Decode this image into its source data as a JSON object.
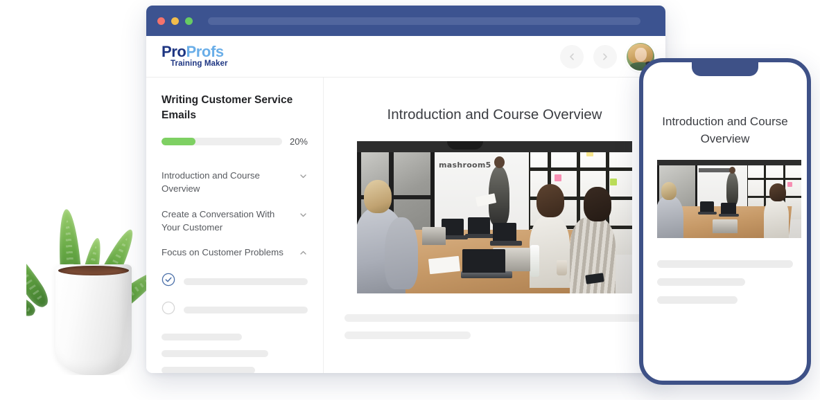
{
  "browser": {
    "window_controls": [
      "close",
      "minimize",
      "maximize"
    ],
    "url_value": "",
    "url_placeholder": ""
  },
  "app": {
    "logo": {
      "part1": "Pro",
      "part2": "Profs",
      "tagline": "Training Maker",
      "color_part1": "#1d3582",
      "color_part2": "#6aaee8"
    },
    "header": {
      "back_label": "Back",
      "forward_label": "Forward",
      "avatar_label": "User profile"
    }
  },
  "sidebar": {
    "course_title": "Writing Customer Service Emails",
    "progress": {
      "percent_label": "20%",
      "value": 20,
      "fill_color": "#7ed063",
      "track_color": "#eeeeee",
      "bar_fill_ratio": 0.28
    },
    "nav_items": [
      {
        "label": "Introduction and Course Overview",
        "expanded": false,
        "chevron": "chevron-down-icon"
      },
      {
        "label": "Create a Conversation With Your Customer",
        "expanded": false,
        "chevron": "chevron-down-icon"
      },
      {
        "label": "Focus on Customer Problems",
        "expanded": true,
        "chevron": "chevron-up-icon"
      }
    ],
    "lessons": [
      {
        "status": "completed",
        "icon": "check-circle-icon",
        "label": ""
      },
      {
        "status": "incomplete",
        "icon": "empty-circle-icon",
        "label": ""
      }
    ],
    "placeholder_lines": [
      {
        "width_pct": 55
      },
      {
        "width_pct": 73
      },
      {
        "width_pct": 64
      }
    ]
  },
  "main": {
    "title": "Introduction and Course Overview",
    "hero_image": {
      "alt": "Office meeting room with presenter at whiteboard and attendees with laptops",
      "wall_text": "mashroom5"
    },
    "placeholder_lines": [
      {
        "width_pct": 100
      },
      {
        "width_pct": 42
      }
    ]
  },
  "phone": {
    "bezel_color": "#3e5187",
    "title": "Introduction and Course Overview",
    "hero_image": {
      "alt": "Office meeting room with presenter at whiteboard and attendees with laptops"
    },
    "placeholder_lines": [
      {
        "width_pct": 100
      },
      {
        "width_pct": 65
      },
      {
        "width_pct": 59
      }
    ]
  },
  "decor": {
    "plant_alt": "Potted aloe plant in white ceramic pot"
  }
}
